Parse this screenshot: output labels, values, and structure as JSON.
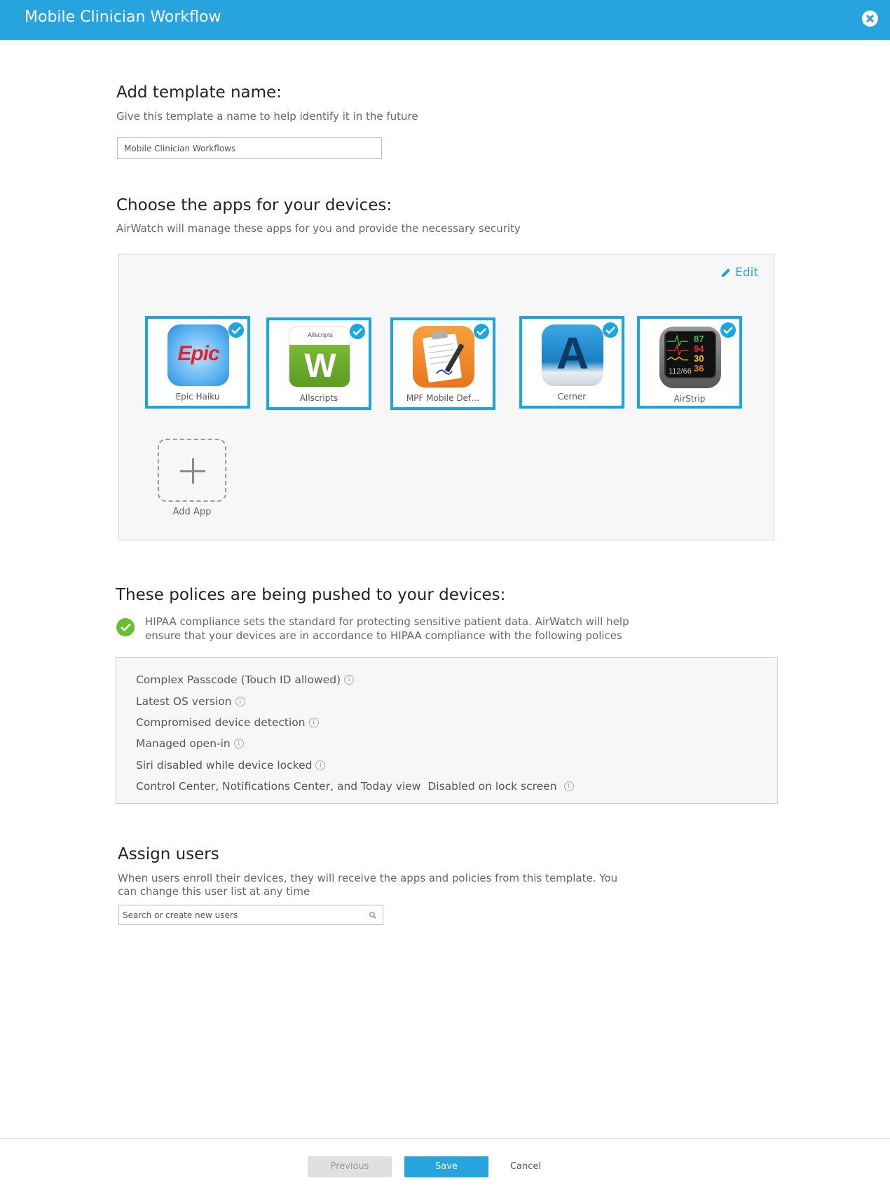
{
  "window": {
    "title": "Mobile Clinician Workflow"
  },
  "template": {
    "heading": "Add template name:",
    "description": "Give this template a name to help identify it in the future",
    "name_value": "Mobile Clinician Workflows"
  },
  "apps": {
    "heading": "Choose the apps for your devices:",
    "description": "AirWatch will manage these apps for you and provide the necessary security",
    "edit_label": "Edit",
    "items": [
      {
        "label": "Epic Haiku",
        "selected": true,
        "icon": "epic-haiku-icon"
      },
      {
        "label": "Allscripts",
        "selected": true,
        "icon": "allscripts-icon"
      },
      {
        "label": "MPF Mobile Def…",
        "selected": true,
        "icon": "mpf-mobile-icon"
      },
      {
        "label": "Cerner",
        "selected": true,
        "icon": "cerner-icon"
      },
      {
        "label": "AirStrip",
        "selected": true,
        "icon": "airstrip-icon"
      }
    ],
    "add_app_label": "Add App",
    "icon_text": {
      "epic": "Epic",
      "allscripts_brand": "Allscripts",
      "allscripts_letter": "W",
      "cerner_letter": "A",
      "airstrip_readings": [
        "87",
        "94",
        "30",
        "36"
      ],
      "airstrip_bp": "112/66"
    }
  },
  "policies": {
    "heading": "These polices are being pushed to your devices:",
    "description": "HIPAA compliance sets the standard for protecting sensitive patient data. AirWatch will help ensure that your devices are in accordance to HIPAA compliance with the following polices",
    "items": [
      "Complex Passcode (Touch ID allowed)",
      "Latest OS version",
      "Compromised device detection",
      "Managed open-in",
      "Siri disabled while device locked",
      "Control Center, Notifications Center, and Today view  Disabled on lock screen"
    ]
  },
  "assign": {
    "heading": "Assign users",
    "description": "When users enroll their devices, they will receive the apps and policies from this template. You can change this user list at any time",
    "search_placeholder": "Search or create new users"
  },
  "footer": {
    "previous_label": "Previous",
    "save_label": "Save",
    "cancel_label": "Cancel"
  },
  "colors": {
    "accent": "#27a3dd",
    "selection_border": "#1ba6e2",
    "success": "#6abf2c"
  }
}
